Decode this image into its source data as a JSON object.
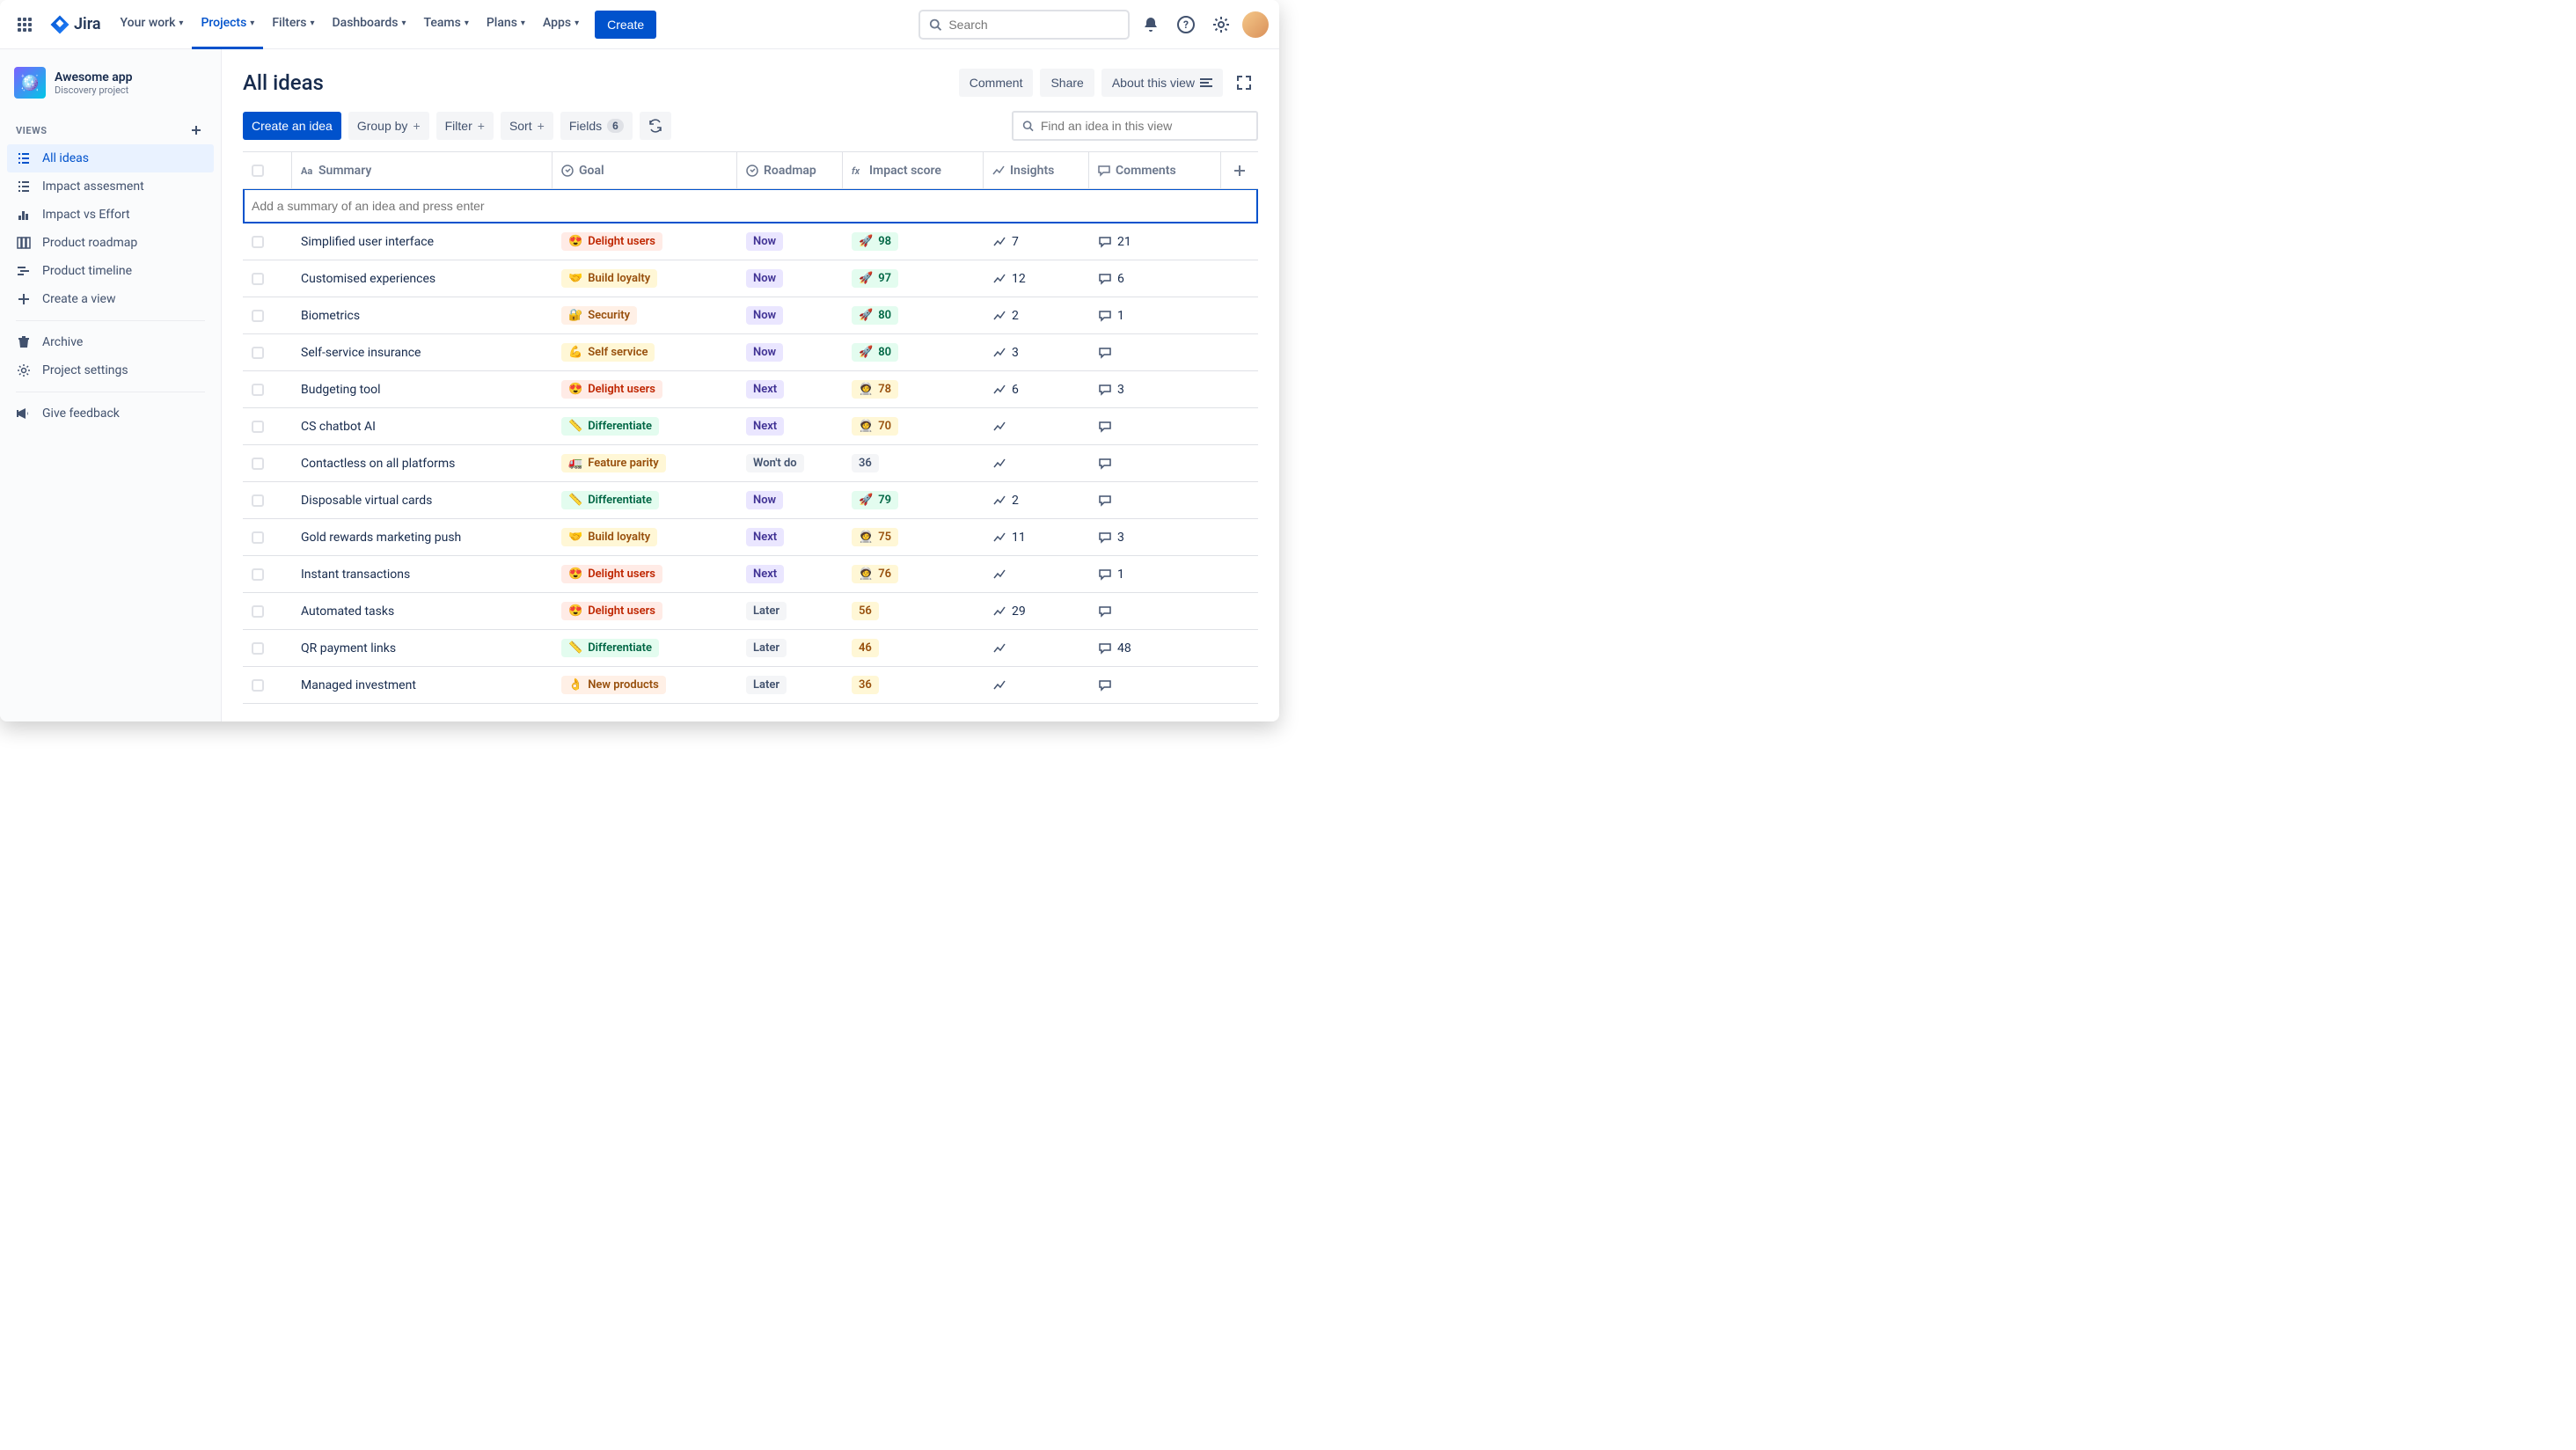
{
  "nav": {
    "product": "Jira",
    "items": [
      "Your work",
      "Projects",
      "Filters",
      "Dashboards",
      "Teams",
      "Plans",
      "Apps"
    ],
    "active": "Projects",
    "create": "Create",
    "search_placeholder": "Search"
  },
  "sidebar": {
    "project": {
      "name": "Awesome app",
      "type": "Discovery project"
    },
    "views_label": "VIEWS",
    "views": [
      {
        "label": "All ideas",
        "icon": "list",
        "active": true
      },
      {
        "label": "Impact assesment",
        "icon": "list"
      },
      {
        "label": "Impact vs Effort",
        "icon": "chart"
      },
      {
        "label": "Product roadmap",
        "icon": "board"
      },
      {
        "label": "Product timeline",
        "icon": "timeline"
      }
    ],
    "create_view": "Create a view",
    "archive": "Archive",
    "settings": "Project settings",
    "feedback": "Give feedback"
  },
  "header": {
    "title": "All ideas",
    "comment": "Comment",
    "share": "Share",
    "about": "About this view"
  },
  "toolbar": {
    "create": "Create an idea",
    "group_by": "Group by",
    "filter": "Filter",
    "sort": "Sort",
    "fields": "Fields",
    "fields_count": "6",
    "search_placeholder": "Find an idea in this view"
  },
  "columns": {
    "summary": "Summary",
    "goal": "Goal",
    "roadmap": "Roadmap",
    "impact": "Impact score",
    "insights": "Insights",
    "comments": "Comments"
  },
  "newrow_placeholder": "Add a summary of an idea and press enter",
  "goals": {
    "delight": {
      "emoji": "😍",
      "label": "Delight users",
      "cls": "goal-delight"
    },
    "loyalty": {
      "emoji": "🤝",
      "label": "Build loyalty",
      "cls": "goal-loyalty"
    },
    "security": {
      "emoji": "🔐",
      "label": "Security",
      "cls": "goal-security"
    },
    "self": {
      "emoji": "💪",
      "label": "Self service",
      "cls": "goal-self"
    },
    "diff": {
      "emoji": "📏",
      "label": "Differentiate",
      "cls": "goal-diff"
    },
    "parity": {
      "emoji": "🚛",
      "label": "Feature parity",
      "cls": "goal-parity"
    },
    "new": {
      "emoji": "👌",
      "label": "New products",
      "cls": "goal-new"
    }
  },
  "roadmap": {
    "now": {
      "label": "Now",
      "cls": "road-now"
    },
    "next": {
      "label": "Next",
      "cls": "road-next"
    },
    "later": {
      "label": "Later",
      "cls": "road-later"
    },
    "wont": {
      "label": "Won't do",
      "cls": "road-wontdo"
    }
  },
  "rows": [
    {
      "summary": "Simplified user interface",
      "goal": "delight",
      "roadmap": "now",
      "impact": {
        "v": "98",
        "cls": "impact-green",
        "emoji": "🚀"
      },
      "insights": "7",
      "comments": "21"
    },
    {
      "summary": "Customised experiences",
      "goal": "loyalty",
      "roadmap": "now",
      "impact": {
        "v": "97",
        "cls": "impact-green",
        "emoji": "🚀"
      },
      "insights": "12",
      "comments": "6"
    },
    {
      "summary": "Biometrics",
      "goal": "security",
      "roadmap": "now",
      "impact": {
        "v": "80",
        "cls": "impact-green",
        "emoji": "🚀"
      },
      "insights": "2",
      "comments": "1"
    },
    {
      "summary": "Self-service insurance",
      "goal": "self",
      "roadmap": "now",
      "impact": {
        "v": "80",
        "cls": "impact-green",
        "emoji": "🚀"
      },
      "insights": "3",
      "comments": ""
    },
    {
      "summary": "Budgeting tool",
      "goal": "delight",
      "roadmap": "next",
      "impact": {
        "v": "78",
        "cls": "impact-yellow",
        "emoji": "🧑‍🚀"
      },
      "insights": "6",
      "comments": "3"
    },
    {
      "summary": "CS chatbot AI",
      "goal": "diff",
      "roadmap": "next",
      "impact": {
        "v": "70",
        "cls": "impact-yellow",
        "emoji": "🧑‍🚀"
      },
      "insights": "",
      "comments": ""
    },
    {
      "summary": "Contactless on all platforms",
      "goal": "parity",
      "roadmap": "wont",
      "impact": {
        "v": "36",
        "cls": "impact-plain",
        "emoji": ""
      },
      "insights": "",
      "comments": ""
    },
    {
      "summary": "Disposable virtual cards",
      "goal": "diff",
      "roadmap": "now",
      "impact": {
        "v": "79",
        "cls": "impact-green",
        "emoji": "🚀"
      },
      "insights": "2",
      "comments": ""
    },
    {
      "summary": "Gold rewards marketing push",
      "goal": "loyalty",
      "roadmap": "next",
      "impact": {
        "v": "75",
        "cls": "impact-yellow",
        "emoji": "🧑‍🚀"
      },
      "insights": "11",
      "comments": "3"
    },
    {
      "summary": "Instant transactions",
      "goal": "delight",
      "roadmap": "next",
      "impact": {
        "v": "76",
        "cls": "impact-yellow",
        "emoji": "🧑‍🚀"
      },
      "insights": "",
      "comments": "1"
    },
    {
      "summary": "Automated tasks",
      "goal": "delight",
      "roadmap": "later",
      "impact": {
        "v": "56",
        "cls": "impact-yellow",
        "emoji": ""
      },
      "insights": "29",
      "comments": ""
    },
    {
      "summary": "QR payment links",
      "goal": "diff",
      "roadmap": "later",
      "impact": {
        "v": "46",
        "cls": "impact-yellow",
        "emoji": ""
      },
      "insights": "",
      "comments": "48"
    },
    {
      "summary": "Managed investment",
      "goal": "new",
      "roadmap": "later",
      "impact": {
        "v": "36",
        "cls": "impact-yellow",
        "emoji": ""
      },
      "insights": "",
      "comments": ""
    }
  ]
}
